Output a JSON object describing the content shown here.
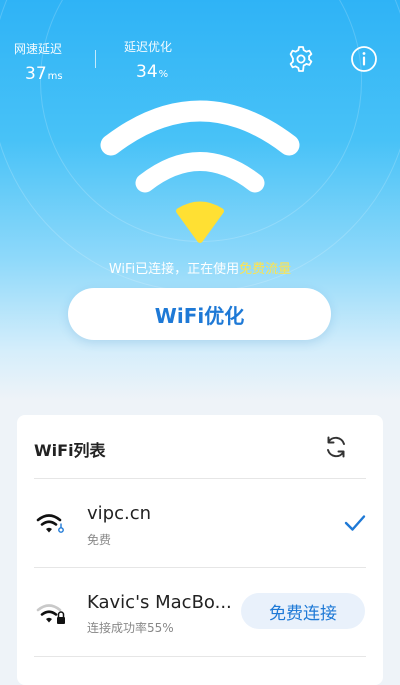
{
  "header": {
    "latency_label": "网速延迟",
    "latency_value": "37",
    "latency_unit": "ms",
    "optimize_label": "延迟优化",
    "optimize_value": "34",
    "optimize_unit": "%",
    "settings_icon": "gear-icon",
    "info_icon": "info-icon"
  },
  "hero": {
    "status_prefix": "WiFi已连接，正在使用",
    "status_highlight": "免费流量",
    "optimize_button": "WiFi优化"
  },
  "wifi_list": {
    "title": "WiFi列表",
    "refresh_icon": "refresh-icon",
    "items": [
      {
        "name": "vipc.cn",
        "subtitle": "免费",
        "connected": true
      },
      {
        "name": "Kavic's MacBo...",
        "subtitle": "连接成功率55%",
        "action": "免费连接",
        "locked": true
      }
    ]
  },
  "colors": {
    "accent": "#1e79d6",
    "highlight": "#ffe44d",
    "wifi_center": "#ffe033"
  }
}
